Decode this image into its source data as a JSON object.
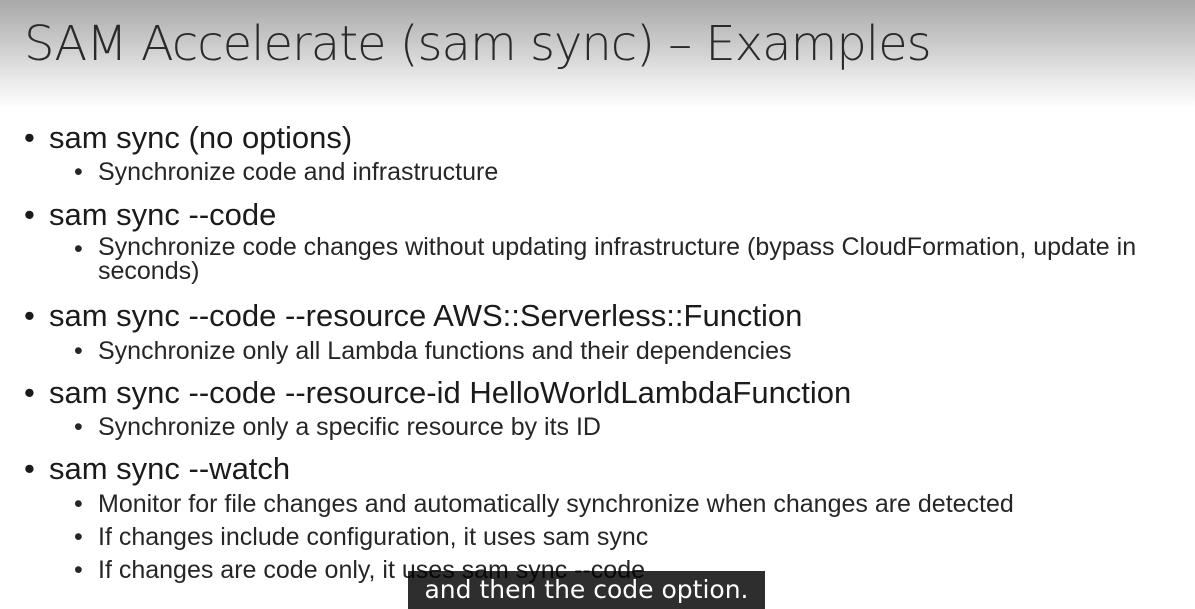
{
  "slide": {
    "title": "SAM Accelerate (sam sync) – Examples",
    "bullets": [
      {
        "label": "sam sync (no options)",
        "sub": [
          "Synchronize code and infrastructure"
        ]
      },
      {
        "label": "sam sync --code",
        "sub": [
          "Synchronize code changes without updating infrastructure (bypass CloudFormation, update in seconds)"
        ]
      },
      {
        "label": "sam sync --code --resource AWS::Serverless::Function",
        "sub": [
          "Synchronize only all Lambda functions and their dependencies"
        ]
      },
      {
        "label": "sam sync --code --resource-id HelloWorldLambdaFunction",
        "sub": [
          "Synchronize only a specific resource by its ID"
        ]
      },
      {
        "label": "sam sync --watch",
        "sub": [
          "Monitor for file changes and automatically synchronize when changes are detected",
          "If changes include configuration, it uses sam sync",
          "If changes are code only, it uses sam sync --code"
        ]
      }
    ]
  },
  "bullet_glyph": "•",
  "caption": {
    "text": "and then the code option."
  }
}
